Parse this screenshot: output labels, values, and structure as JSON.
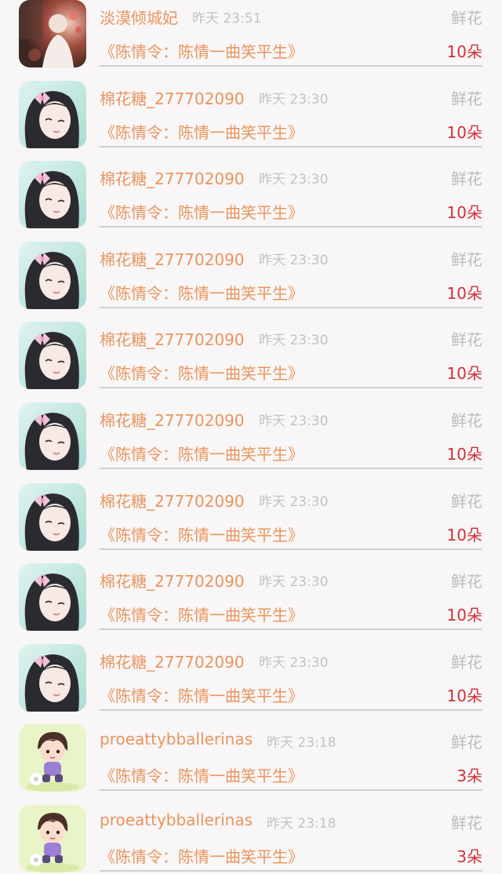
{
  "colors": {
    "background": "#f8f6f6",
    "name": "#e8955f",
    "time": "#c3c3c3",
    "gift_type": "#bcbcbc",
    "count": "#d0313a",
    "divider": "#cfcfcf"
  },
  "items": [
    {
      "avatar": "avatar-photo-red",
      "name": "淡漠倾城妃",
      "time": "昨天 23:51",
      "gift_type": "鲜花",
      "book": "《陈情令：陈情一曲笑平生》",
      "count": "10朵"
    },
    {
      "avatar": "avatar-girl-bow",
      "name": "棉花糖_277702090",
      "time": "昨天 23:30",
      "gift_type": "鲜花",
      "book": "《陈情令：陈情一曲笑平生》",
      "count": "10朵"
    },
    {
      "avatar": "avatar-girl-bow",
      "name": "棉花糖_277702090",
      "time": "昨天 23:30",
      "gift_type": "鲜花",
      "book": "《陈情令：陈情一曲笑平生》",
      "count": "10朵"
    },
    {
      "avatar": "avatar-girl-bow",
      "name": "棉花糖_277702090",
      "time": "昨天 23:30",
      "gift_type": "鲜花",
      "book": "《陈情令：陈情一曲笑平生》",
      "count": "10朵"
    },
    {
      "avatar": "avatar-girl-bow",
      "name": "棉花糖_277702090",
      "time": "昨天 23:30",
      "gift_type": "鲜花",
      "book": "《陈情令：陈情一曲笑平生》",
      "count": "10朵"
    },
    {
      "avatar": "avatar-girl-bow",
      "name": "棉花糖_277702090",
      "time": "昨天 23:30",
      "gift_type": "鲜花",
      "book": "《陈情令：陈情一曲笑平生》",
      "count": "10朵"
    },
    {
      "avatar": "avatar-girl-bow",
      "name": "棉花糖_277702090",
      "time": "昨天 23:30",
      "gift_type": "鲜花",
      "book": "《陈情令：陈情一曲笑平生》",
      "count": "10朵"
    },
    {
      "avatar": "avatar-girl-bow",
      "name": "棉花糖_277702090",
      "time": "昨天 23:30",
      "gift_type": "鲜花",
      "book": "《陈情令：陈情一曲笑平生》",
      "count": "10朵"
    },
    {
      "avatar": "avatar-girl-bow",
      "name": "棉花糖_277702090",
      "time": "昨天 23:30",
      "gift_type": "鲜花",
      "book": "《陈情令：陈情一曲笑平生》",
      "count": "10朵"
    },
    {
      "avatar": "avatar-cartoon-boy",
      "name": "proeattybballerinas",
      "time": "昨天 23:18",
      "gift_type": "鲜花",
      "book": "《陈情令：陈情一曲笑平生》",
      "count": "3朵"
    },
    {
      "avatar": "avatar-cartoon-boy",
      "name": "proeattybballerinas",
      "time": "昨天 23:18",
      "gift_type": "鲜花",
      "book": "《陈情令：陈情一曲笑平生》",
      "count": "3朵"
    }
  ]
}
